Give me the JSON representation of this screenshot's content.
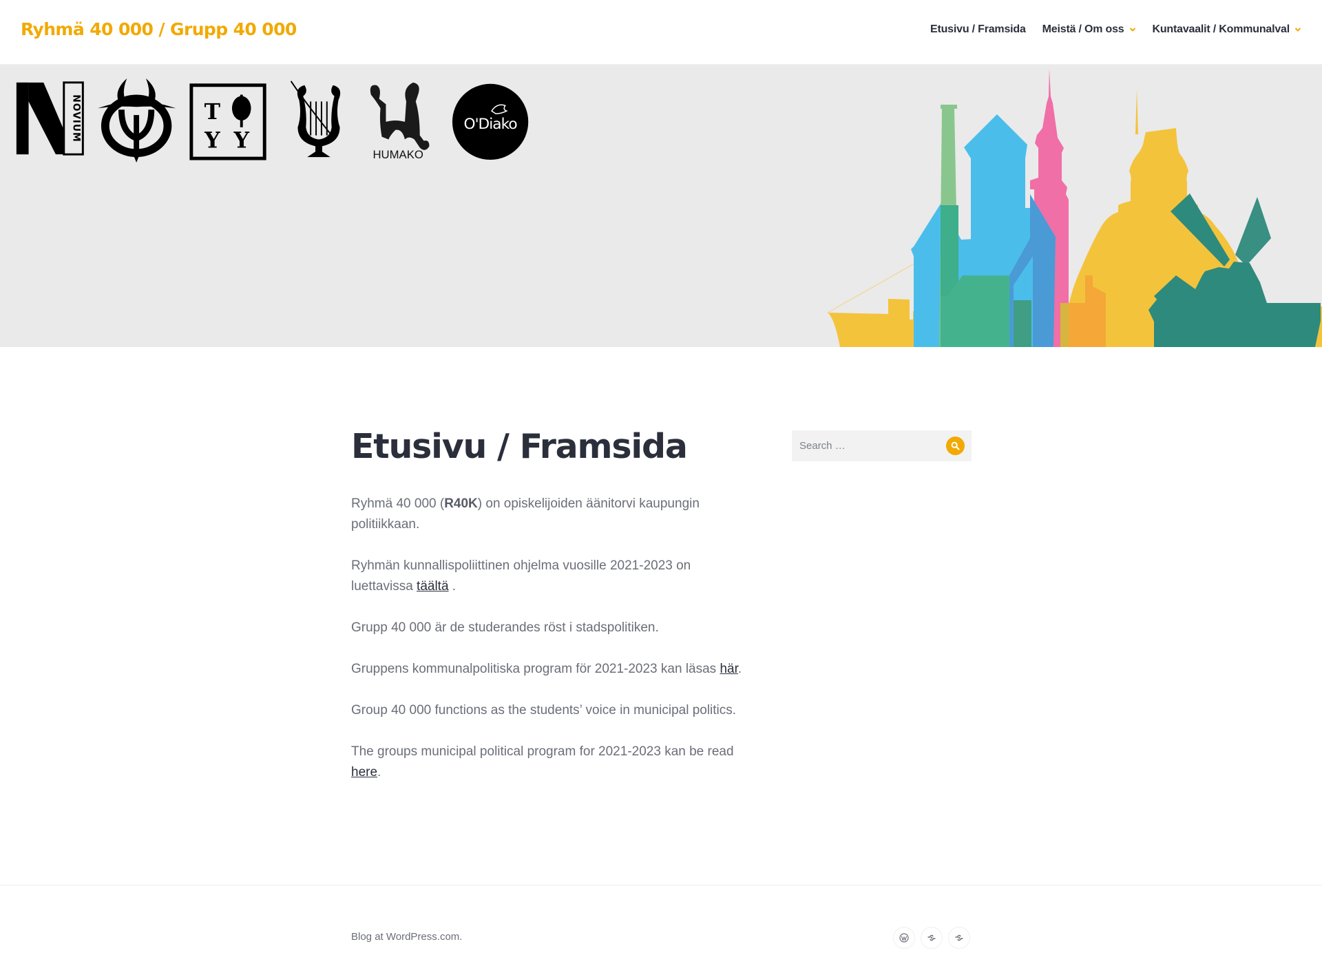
{
  "header": {
    "site_title": "Ryhmä 40 000 / Grupp 40 000",
    "nav": [
      {
        "label": "Etusivu / Framsida",
        "has_submenu": false
      },
      {
        "label": "Meistä / Om oss",
        "has_submenu": true
      },
      {
        "label": "Kuntavaalit / Kommunalval",
        "has_submenu": true
      }
    ]
  },
  "hero": {
    "logos": [
      "Novium",
      "Ylioppilaskunta emblem",
      "TYY",
      "Lyre emblem",
      "HUMAKO",
      "O'Diako"
    ],
    "logo_text": {
      "novium": "NOVIUM",
      "humako": "HUMAKO",
      "odiako": "O'Diako",
      "tyy_t": "T",
      "tyy_y1": "Y",
      "tyy_y2": "Y"
    },
    "illustration": "colorful city skyline silhouette"
  },
  "main": {
    "title": "Etusivu / Framsida",
    "paragraphs": [
      {
        "pre": "Ryhmä 40 000 (",
        "bold": "R40K",
        "post": ") on opiskelijoiden äänitorvi kaupungin politiikkaan."
      },
      {
        "pre": "Ryhmän kunnallispoliittinen ohjelma vuosille 2021-2023 on luettavissa ",
        "link": "täältä",
        "post": " ."
      },
      {
        "text": "Grupp 40 000 är de studerandes röst i stadspolitiken."
      },
      {
        "pre": "Gruppens kommunalpolitiska program för 2021-2023 kan läsas ",
        "link": "här",
        "post": "."
      },
      {
        "text": "Group 40 000 functions as the students’ voice in municipal politics."
      },
      {
        "pre": "The groups municipal political program for 2021-2023 kan be read ",
        "link": "here",
        "post": "."
      }
    ]
  },
  "sidebar": {
    "search": {
      "placeholder": "Search …",
      "value": ""
    }
  },
  "footer": {
    "credit": "Blog at WordPress.com.",
    "social": [
      "wordpress-icon",
      "link-icon",
      "link-icon"
    ]
  },
  "colors": {
    "accent": "#f2a900",
    "text_dark": "#2a2f3b",
    "text_body": "#6b6e78",
    "hero_bg": "#eaeaea"
  }
}
